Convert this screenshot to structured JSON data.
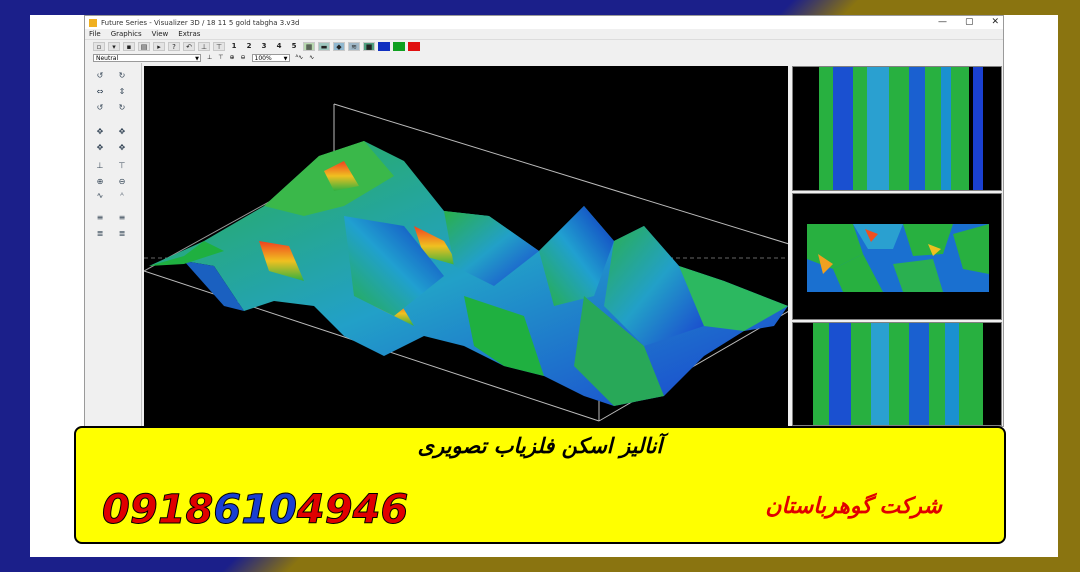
{
  "window": {
    "title": "Future Series - Visualizer 3D / 18 11 5 gold tabgha 3.v3d",
    "controls": {
      "minimize": "—",
      "maximize": "▢",
      "close": "✕"
    }
  },
  "menu": [
    "File",
    "Graphics",
    "View",
    "Extras"
  ],
  "toolbar": {
    "numbers": [
      "1",
      "2",
      "3",
      "4",
      "5"
    ],
    "color_swatches": [
      "#1030c0",
      "#10a020",
      "#e01010"
    ]
  },
  "toolbar2": {
    "palette_select": "Neutral",
    "zoom_select": "100%"
  },
  "banner": {
    "title": "آنالیز اسکن فلزیاب تصویری",
    "phone_digits": [
      "0",
      "9",
      "1",
      "8",
      "6",
      "1",
      "0",
      "4",
      "9",
      "4",
      "6"
    ],
    "phone_colors": [
      "#e00000",
      "#e00000",
      "#e00000",
      "#e00000",
      "#1a3fd0",
      "#1a3fd0",
      "#1a3fd0",
      "#e00000",
      "#e00000",
      "#e00000",
      "#e00000"
    ],
    "company": "شرکت گوهرباستان"
  },
  "colors": {
    "frame_blue": "#1b1f8a",
    "frame_gold": "#8a7410",
    "banner_bg": "#ffff00"
  }
}
